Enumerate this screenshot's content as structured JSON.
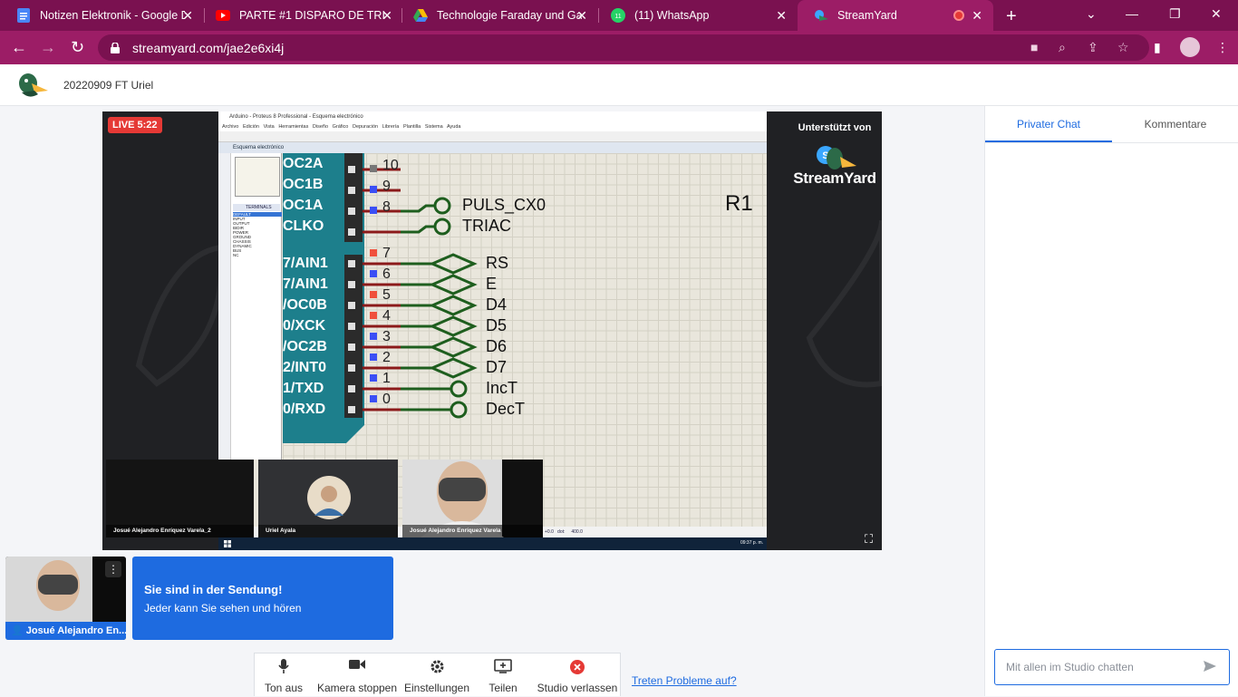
{
  "browser": {
    "tabs": [
      {
        "title": "Notizen Elektronik - Google D",
        "icon": "google-docs-icon",
        "color": "#4a86f7"
      },
      {
        "title": "PARTE #1 DISPARO DE TRIAC",
        "icon": "youtube-icon",
        "color": "#ff0000"
      },
      {
        "title": "Technologie Faraday und Gal",
        "icon": "google-drive-icon",
        "color": "#fbbc04"
      },
      {
        "title": "(11) WhatsApp",
        "icon": "whatsapp-icon",
        "color": "#25d366"
      },
      {
        "title": "StreamYard",
        "icon": "streamyard-icon",
        "color": "#3aa7ff"
      }
    ],
    "url": "streamyard.com/jae2e6xi4j"
  },
  "studio": {
    "broadcast_title": "20220909 FT Uriel",
    "live_badge": "LIVE 5:22",
    "sponsor_line": "Unterstützt von",
    "sponsor_brand": "StreamYard"
  },
  "proteus": {
    "window_title": "Arduino - Proteus 8 Professional - Esquema electrónico",
    "menu": [
      "Archivo",
      "Edición",
      "Vista",
      "Herramientas",
      "Diseño",
      "Gráfico",
      "Depuración",
      "Librería",
      "Plantilla",
      "Sistema",
      "Ayuda"
    ],
    "doc_tab": "Esquema electrónico",
    "panel_header": "TERMINALS",
    "terminals": [
      "DEFAULT",
      "INPUT",
      "OUTPUT",
      "BIDIR",
      "POWER",
      "GROUND",
      "CHASSIS",
      "DYNAMIC",
      "BUS",
      "NC"
    ],
    "pin_labels": [
      "OC2A",
      "OC1B",
      "OC1A",
      "CLKO",
      "7/AIN1",
      "7/AIN1",
      "/OC0B",
      "0/XCK",
      "/OC2B",
      "2/INT0",
      "1/TXD",
      "0/RXD"
    ],
    "pin_numbers_top": [
      "10",
      "9",
      "8"
    ],
    "pin_numbers_bottom": [
      "7",
      "6",
      "5",
      "4",
      "3",
      "2",
      "1",
      "0"
    ],
    "net_labels_top": [
      "PULS_CX0",
      "TRIAC"
    ],
    "net_labels_bottom": [
      "RS",
      "E",
      "D4",
      "D5",
      "D6",
      "D7",
      "IncT",
      "DecT"
    ],
    "resistor_label": "R1",
    "status_values": [
      "+0.0",
      "dot:",
      "400.0"
    ],
    "clock": "09:37 p. m."
  },
  "stage_tiles": [
    {
      "name": "Josué Alejandro Enríquez Varela_2"
    },
    {
      "name": "Uriel Ayala"
    },
    {
      "name": "Josué Alejandro Enríquez Varela"
    }
  ],
  "self_preview": {
    "name": "Josué Alejandro En..."
  },
  "on_air_banner": {
    "title": "Sie sind in der Sendung!",
    "subtitle": "Jeder kann Sie sehen und hören"
  },
  "controls": [
    {
      "label": "Ton aus",
      "icon": "microphone-icon"
    },
    {
      "label": "Kamera stoppen",
      "icon": "camera-icon"
    },
    {
      "label": "Einstellungen",
      "icon": "gear-icon"
    },
    {
      "label": "Teilen",
      "icon": "share-screen-icon"
    },
    {
      "label": "Studio verlassen",
      "icon": "leave-icon"
    }
  ],
  "help_link": "Treten Probleme auf?",
  "chat": {
    "tabs": [
      "Privater Chat",
      "Kommentare"
    ],
    "input_placeholder": "Mit allen im Studio chatten"
  },
  "colors": {
    "browser_frame": "#7a1150",
    "browser_active": "#9c1d66",
    "accent_blue": "#1e6be0",
    "live_red": "#e53935",
    "leave_red": "#e53935"
  }
}
